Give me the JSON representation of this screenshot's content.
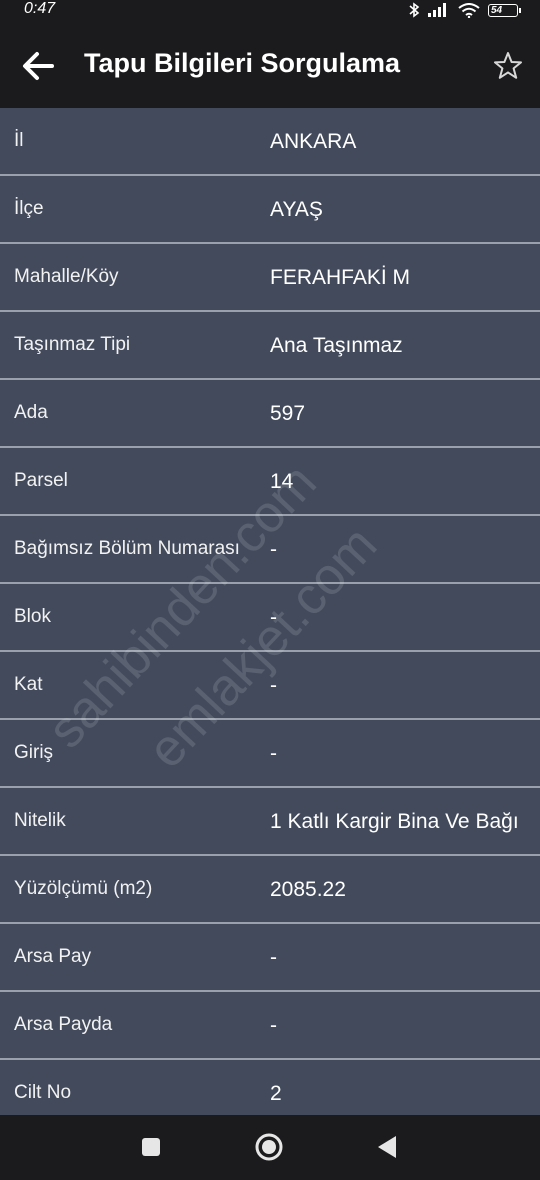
{
  "status_bar": {
    "time": "0:47",
    "battery": "54",
    "icons": [
      "bluetooth-icon",
      "signal-icon",
      "wifi-icon",
      "battery-icon"
    ]
  },
  "app_bar": {
    "title": "Tapu Bilgileri Sorgulama",
    "back_icon": "arrow-left-icon",
    "favorite_icon": "star-outline-icon"
  },
  "fields": [
    {
      "label": "İl",
      "value": "ANKARA"
    },
    {
      "label": "İlçe",
      "value": "AYAŞ"
    },
    {
      "label": "Mahalle/Köy",
      "value": "FERAHFAKİ M"
    },
    {
      "label": "Taşınmaz Tipi",
      "value": "Ana Taşınmaz"
    },
    {
      "label": "Ada",
      "value": "597"
    },
    {
      "label": "Parsel",
      "value": "14"
    },
    {
      "label": "Bağımsız Bölüm Numarası",
      "value": "-"
    },
    {
      "label": "Blok",
      "value": "-"
    },
    {
      "label": "Kat",
      "value": "-"
    },
    {
      "label": "Giriş",
      "value": "-"
    },
    {
      "label": "Nitelik",
      "value": "1 Katlı Kargir Bina Ve Bağı"
    },
    {
      "label": "Yüzölçümü (m2)",
      "value": "2085.22"
    },
    {
      "label": "Arsa Pay",
      "value": "-"
    },
    {
      "label": "Arsa Payda",
      "value": "-"
    },
    {
      "label": "Cilt No",
      "value": "2"
    }
  ],
  "watermarks": [
    "sahibinden.com",
    "emlakjet.com"
  ],
  "nav_bar": {
    "icons": [
      "recents-square-icon",
      "home-circle-icon",
      "back-triangle-icon"
    ]
  },
  "colors": {
    "bar_background": "#1b1b1d",
    "list_background": "#424a5c",
    "divider": "#9aa1ad"
  }
}
